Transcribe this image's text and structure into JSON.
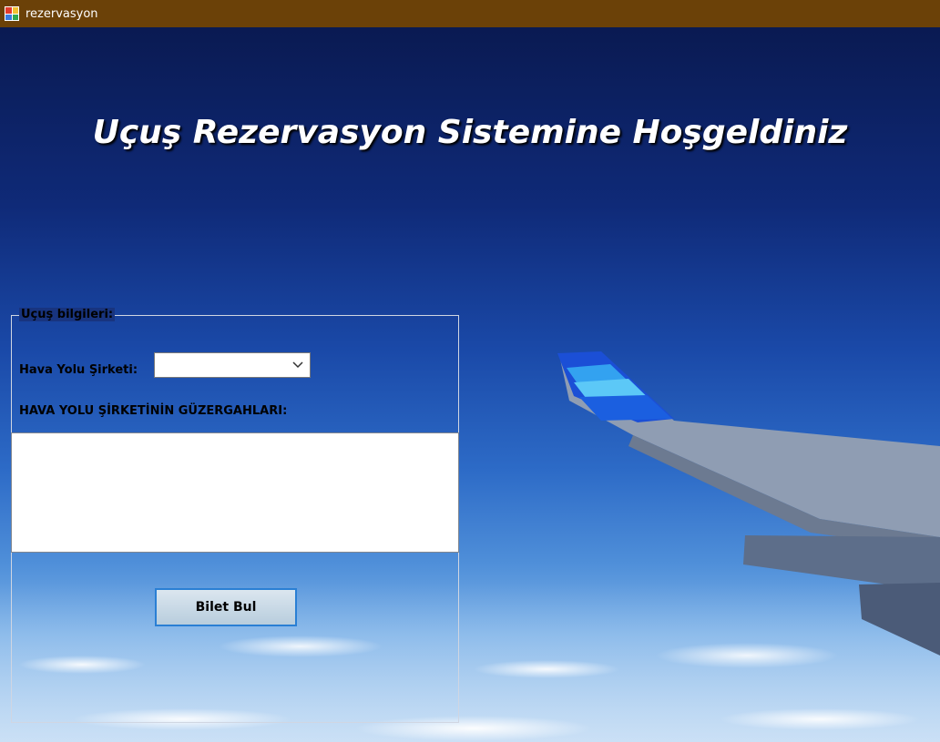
{
  "window": {
    "title": "rezervasyon",
    "titlebar_color": "#6b4108"
  },
  "welcome": {
    "text": "Uçuş Rezervasyon Sistemine Hoşgeldiniz"
  },
  "group": {
    "legend": "Uçuş bilgileri:",
    "airline_label": "Hava Yolu Şirketi:",
    "airline_select": {
      "selected": "",
      "icon": "chevron-down-icon"
    },
    "routes_label": "HAVA YOLU ŞİRKETİNİN GÜZERGAHLARI:",
    "routes_items": []
  },
  "button": {
    "label": "Bilet Bul",
    "border_color": "#2a7fd4"
  }
}
